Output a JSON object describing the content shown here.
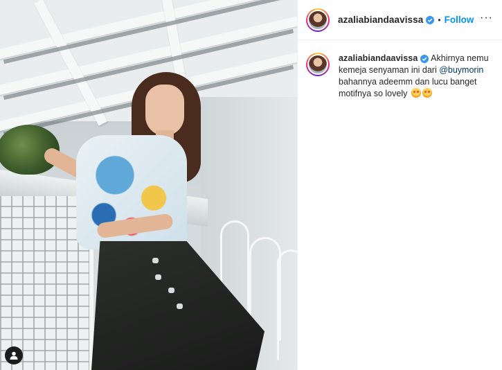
{
  "post": {
    "username": "azaliabiandaavissa",
    "follow_label": "Follow",
    "separator": "•",
    "more_label": "···"
  },
  "caption": {
    "username": "azaliabiandaavissa",
    "text_before": " Akhirnya nemu kemeja senyaman ini dari ",
    "mention": "@buymorin",
    "text_after": " bahannya adeemm dan lucu banget motifnya so lovely "
  },
  "icons": {
    "verified": "verified-badge-icon",
    "user_tag": "user-tag-icon",
    "emoji": "smiling-face-with-heart-eyes-icon"
  },
  "colors": {
    "follow": "#0095f6",
    "mention": "#00376b",
    "verified": "#3897f0"
  }
}
